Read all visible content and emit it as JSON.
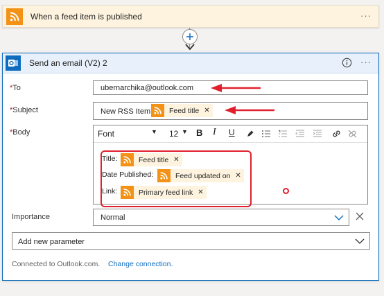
{
  "trigger": {
    "title": "When a feed item is published",
    "icon": "rss-icon"
  },
  "action": {
    "title": "Send an email (V2) 2",
    "to": {
      "label": "To",
      "value": "ubernarchika@outlook.com"
    },
    "subject": {
      "label": "Subject",
      "prefix": "New RSS Item:",
      "token": "Feed title"
    },
    "body": {
      "label": "Body",
      "font": "Font",
      "font_size": "12",
      "lines": [
        {
          "label": "Title:",
          "token": "Feed title"
        },
        {
          "label": "Date Published:",
          "token": "Feed updated on"
        },
        {
          "label": "Link:",
          "token": "Primary feed link"
        }
      ]
    },
    "importance": {
      "label": "Importance",
      "value": "Normal"
    },
    "add_param": {
      "label": "Add new parameter"
    },
    "footer": {
      "connected": "Connected to Outlook.com.",
      "change_link": "Change connection."
    }
  },
  "colors": {
    "rss": "#f39216",
    "token_bg": "#fdf3df",
    "accent": "#0f6cbd",
    "annotation": "#e0202e"
  }
}
